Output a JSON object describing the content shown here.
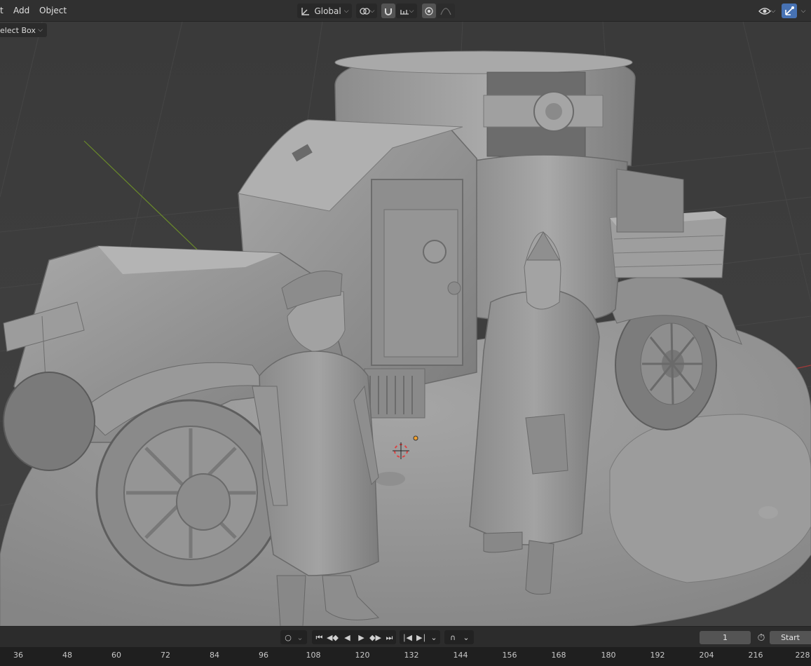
{
  "header": {
    "menu": [
      "t",
      "Add",
      "Object"
    ],
    "transform_orientation": "Global",
    "icons": {
      "orientation": "transform-orientation-icon",
      "pivot": "pivot-point-icon",
      "snap": "snap-magnet-icon",
      "snap_target": "snap-increment-icon",
      "proportional": "proportional-editing-icon",
      "falloff": "falloff-curve-icon",
      "visibility": "viewport-visibility-icon",
      "gizmo": "gizmo-toggle-icon"
    }
  },
  "toolbar": {
    "select_mode": "elect Box"
  },
  "viewport": {
    "scene": "sculpted-armored-car-diorama",
    "x_axis_color": "#a63a3a",
    "y_axis_color": "#6a8a2a",
    "mesh_color": "#9a9a9a"
  },
  "timeline": {
    "current_frame": "1",
    "start_label": "Start",
    "ruler_ticks": [
      "36",
      "48",
      "60",
      "72",
      "84",
      "96",
      "108",
      "120",
      "132",
      "144",
      "156",
      "168",
      "180",
      "192",
      "204",
      "216",
      "228"
    ]
  },
  "colors": {
    "accent": "#4772b3",
    "header_bg": "#303030",
    "ruler_bg": "#1f1f1f"
  }
}
